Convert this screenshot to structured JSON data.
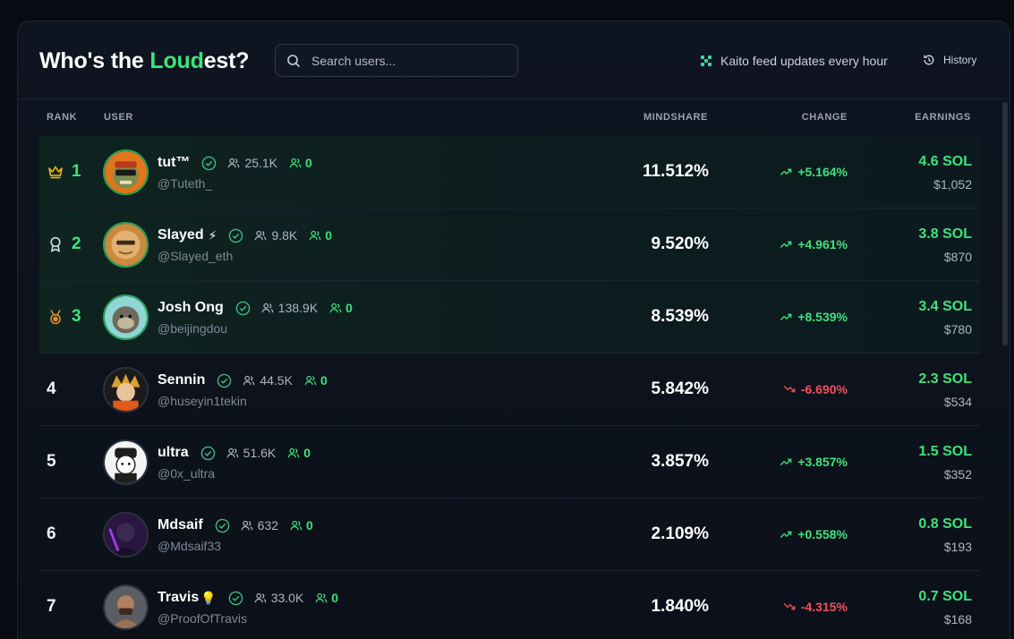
{
  "header": {
    "title_prefix": "Who's the ",
    "title_accent": "Loud",
    "title_suffix": "est?",
    "search_placeholder": "Search users...",
    "feed_text": "Kaito feed updates every hour",
    "history_label": "History"
  },
  "columns": {
    "rank": "RANK",
    "user": "USER",
    "mindshare": "MINDSHARE",
    "change": "CHANGE",
    "earnings": "EARNINGS"
  },
  "colors": {
    "accent_green": "#3ee37a",
    "negative_red": "#f0515b"
  },
  "rows": [
    {
      "rank": "1",
      "rank_icon": "crown-icon",
      "name": "tut™",
      "followers": "25.1K",
      "friends": "0",
      "handle": "@Tuteth_",
      "mindshare": "11.512%",
      "change": "+5.164%",
      "direction": "up",
      "sol": "4.6 SOL",
      "usd": "$1,052"
    },
    {
      "rank": "2",
      "rank_icon": "silver-medal-icon",
      "name": "Slayed",
      "name_emoji": "⚡",
      "followers": "9.8K",
      "friends": "0",
      "handle": "@Slayed_eth",
      "mindshare": "9.520%",
      "change": "+4.961%",
      "direction": "up",
      "sol": "3.8 SOL",
      "usd": "$870"
    },
    {
      "rank": "3",
      "rank_icon": "bronze-medal-icon",
      "name": "Josh Ong",
      "followers": "138.9K",
      "friends": "0",
      "handle": "@beijingdou",
      "mindshare": "8.539%",
      "change": "+8.539%",
      "direction": "up",
      "sol": "3.4 SOL",
      "usd": "$780"
    },
    {
      "rank": "4",
      "name": "Sennin",
      "followers": "44.5K",
      "friends": "0",
      "handle": "@huseyin1tekin",
      "mindshare": "5.842%",
      "change": "-6.690%",
      "direction": "down",
      "sol": "2.3 SOL",
      "usd": "$534"
    },
    {
      "rank": "5",
      "name": "ultra",
      "followers": "51.6K",
      "friends": "0",
      "handle": "@0x_ultra",
      "mindshare": "3.857%",
      "change": "+3.857%",
      "direction": "up",
      "sol": "1.5 SOL",
      "usd": "$352"
    },
    {
      "rank": "6",
      "name": "Mdsaif",
      "followers": "632",
      "friends": "0",
      "handle": "@Mdsaif33",
      "mindshare": "2.109%",
      "change": "+0.558%",
      "direction": "up",
      "sol": "0.8 SOL",
      "usd": "$193"
    },
    {
      "rank": "7",
      "name": "Travis",
      "name_emoji": "💡",
      "followers": "33.0K",
      "friends": "0",
      "handle": "@ProofOfTravis",
      "mindshare": "1.840%",
      "change": "-4.315%",
      "direction": "down",
      "sol": "0.7 SOL",
      "usd": "$168"
    }
  ]
}
